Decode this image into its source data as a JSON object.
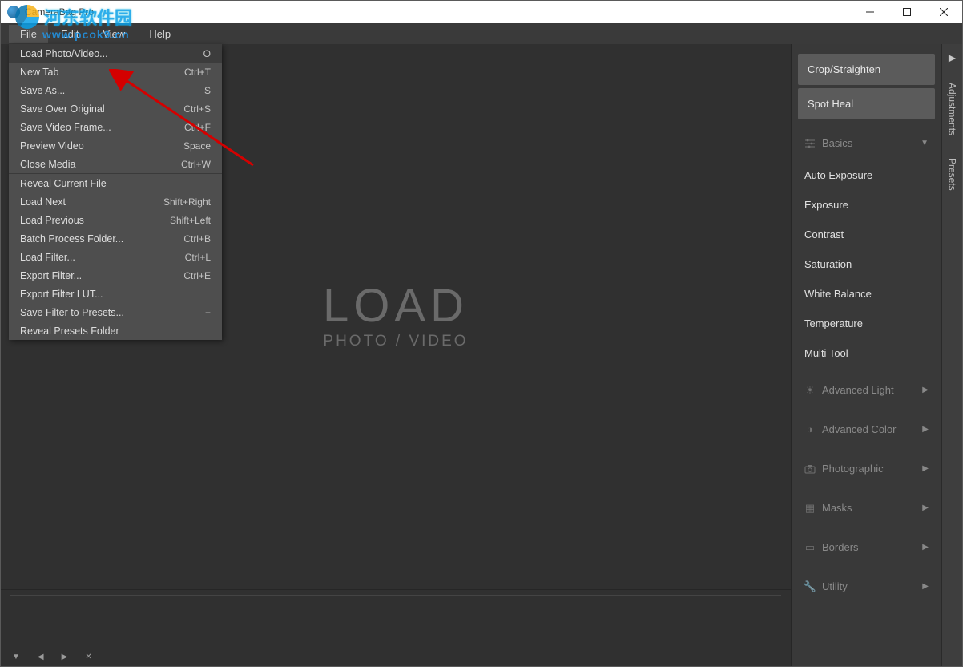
{
  "window": {
    "title": "CameraBag Pro"
  },
  "menubar": [
    "File",
    "Edit",
    "View",
    "Help"
  ],
  "file_menu": {
    "group1": [
      {
        "label": "Load Photo/Video...",
        "shortcut": "O",
        "hover": true
      },
      {
        "label": "New Tab",
        "shortcut": "Ctrl+T"
      },
      {
        "label": "Save As...",
        "shortcut": "S"
      },
      {
        "label": "Save Over Original",
        "shortcut": "Ctrl+S"
      },
      {
        "label": "Save Video Frame...",
        "shortcut": "Ctrl+F"
      },
      {
        "label": "Preview Video",
        "shortcut": "Space"
      },
      {
        "label": "Close Media",
        "shortcut": "Ctrl+W"
      }
    ],
    "group2": [
      {
        "label": "Reveal Current File",
        "shortcut": ""
      },
      {
        "label": "Load Next",
        "shortcut": "Shift+Right"
      },
      {
        "label": "Load Previous",
        "shortcut": "Shift+Left"
      },
      {
        "label": "Batch Process Folder...",
        "shortcut": "Ctrl+B"
      },
      {
        "label": "Load Filter...",
        "shortcut": "Ctrl+L"
      },
      {
        "label": "Export Filter...",
        "shortcut": "Ctrl+E"
      },
      {
        "label": "Export Filter LUT...",
        "shortcut": ""
      },
      {
        "label": "Save Filter to Presets...",
        "shortcut": "+"
      },
      {
        "label": "Reveal Presets Folder",
        "shortcut": ""
      }
    ]
  },
  "canvas": {
    "big": "LOAD",
    "small": "PHOTO / VIDEO"
  },
  "side": {
    "crop": "Crop/Straighten",
    "spot": "Spot Heal",
    "groups": {
      "basics": "Basics",
      "advanced_light": "Advanced Light",
      "advanced_color": "Advanced Color",
      "photographic": "Photographic",
      "masks": "Masks",
      "borders": "Borders",
      "utility": "Utility"
    },
    "basics_items": [
      "Auto Exposure",
      "Exposure",
      "Contrast",
      "Saturation",
      "White Balance",
      "Temperature",
      "Multi Tool"
    ]
  },
  "vtabs": {
    "adjustments": "Adjustments",
    "presets": "Presets"
  },
  "watermark": {
    "line1": "河东软件园",
    "line2": "www.pcok9.cn"
  }
}
